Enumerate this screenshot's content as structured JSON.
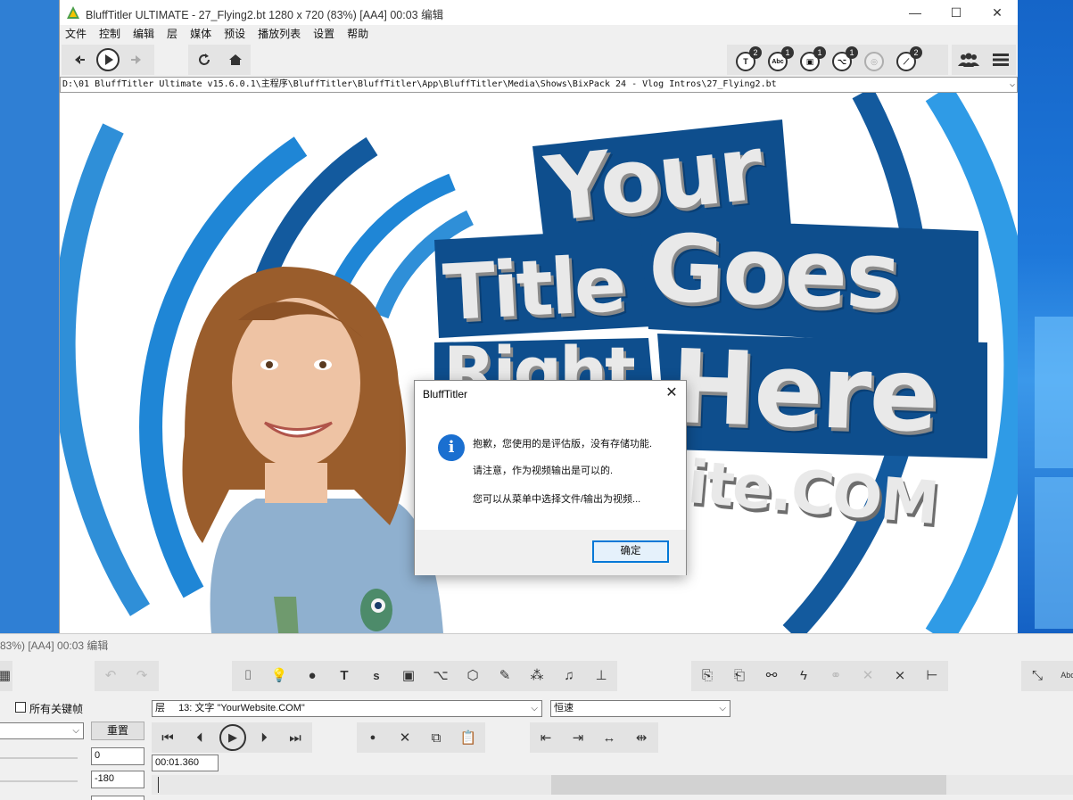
{
  "window": {
    "title": "BluffTitler ULTIMATE  - 27_Flying2.bt 1280 x 720 (83%) [AA4] 00:03 编辑",
    "minimize": "—",
    "maximize": "☐",
    "close": "✕"
  },
  "menu": [
    "文件",
    "控制",
    "编辑",
    "层",
    "媒体",
    "预设",
    "播放列表",
    "设置",
    "帮助"
  ],
  "toolbar": {
    "badges": [
      {
        "icon": "text-layer-icon",
        "glyph": "T",
        "count": "2"
      },
      {
        "icon": "abc-layer-icon",
        "glyph": "Abc",
        "count": "1"
      },
      {
        "icon": "picture-layer-icon",
        "glyph": "▣",
        "count": "1"
      },
      {
        "icon": "path-layer-icon",
        "glyph": "⌥",
        "count": "1"
      },
      {
        "icon": "disabled-layer-icon",
        "glyph": "◎",
        "count": ""
      },
      {
        "icon": "light-layer-icon",
        "glyph": "⟋",
        "count": "2"
      }
    ]
  },
  "path": "D:\\01 BluffTitler Ultimate v15.6.0.1\\主程序\\BluffTitler\\BluffTitler\\App\\BluffTitler\\Media\\Shows\\BixPack 24 - Vlog Intros\\27_Flying2.bt",
  "scene": {
    "line1": "Your",
    "line2a": "Title",
    "line2b": "Goes",
    "line3a": "Right",
    "line3b": "Here",
    "line4": "YourWebsite.COM",
    "line4_visible": "ite.COM"
  },
  "editor": {
    "title": "83%) [AA4] 00:03 编辑",
    "all_keyframes": "所有关键帧",
    "reset": "重置",
    "layer_label": "层",
    "layer_value": "13: 文字 \"YourWebsite.COM\"",
    "speed_value": "恒速",
    "value1": "0",
    "value2": "-180",
    "time": "00:01.360"
  },
  "dialog": {
    "title": "BluffTitler",
    "line1": "抱歉，您使用的是评估版，没有存储功能.",
    "line2": "请注意，作为视频输出是可以的.",
    "line3": "您可以从菜单中选择文件/输出为视频...",
    "ok": "确定"
  }
}
